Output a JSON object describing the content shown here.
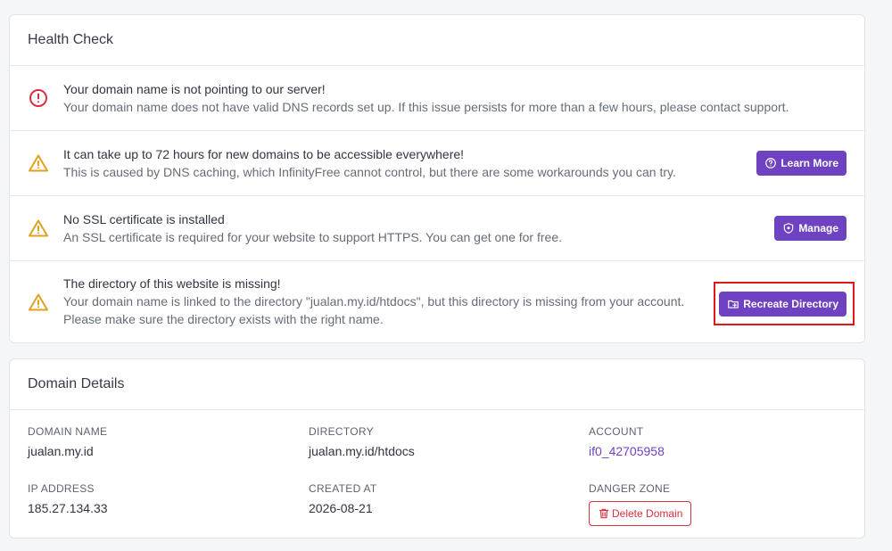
{
  "health_check": {
    "title": "Health Check",
    "alerts": [
      {
        "icon": "alert-circle-icon",
        "severity_color": "#d9303e",
        "title": "Your domain name is not pointing to our server!",
        "description": "Your domain name does not have valid DNS records set up. If this issue persists for more than a few hours, please contact support."
      },
      {
        "icon": "warning-triangle-icon",
        "severity_color": "#e0a020",
        "title": "It can take up to 72 hours for new domains to be accessible everywhere!",
        "description": "This is caused by DNS caching, which InfinityFree cannot control, but there are some workarounds you can try.",
        "button": {
          "label": "Learn More",
          "icon": "help-circle-icon"
        }
      },
      {
        "icon": "warning-triangle-icon",
        "severity_color": "#e0a020",
        "title": "No SSL certificate is installed",
        "description": "An SSL certificate is required for your website to support HTTPS. You can get one for free.",
        "button": {
          "label": "Manage",
          "icon": "shield-icon"
        }
      },
      {
        "icon": "warning-triangle-icon",
        "severity_color": "#e0a020",
        "title": "The directory of this website is missing!",
        "description_line1": "Your domain name is linked to the directory \"jualan.my.id/htdocs\", but this directory is missing from your account.",
        "description_line2": "Please make sure the directory exists with the right name.",
        "button": {
          "label": "Recreate Directory",
          "icon": "folder-plus-icon"
        }
      }
    ]
  },
  "domain_details": {
    "title": "Domain Details",
    "domain_name": {
      "label": "DOMAIN NAME",
      "value": "jualan.my.id"
    },
    "directory": {
      "label": "DIRECTORY",
      "value": "jualan.my.id/htdocs"
    },
    "account": {
      "label": "ACCOUNT",
      "value": "if0_42705958"
    },
    "ip_address": {
      "label": "IP ADDRESS",
      "value": "185.27.134.33"
    },
    "created_at": {
      "label": "CREATED AT",
      "value": "2026-08-21"
    },
    "danger_zone": {
      "label": "DANGER ZONE",
      "button_label": "Delete Domain",
      "icon": "trash-icon"
    }
  },
  "colors": {
    "accent": "#6f42c1",
    "danger": "#d9303e",
    "warning": "#e0a020",
    "highlight_box": "#e01818"
  }
}
